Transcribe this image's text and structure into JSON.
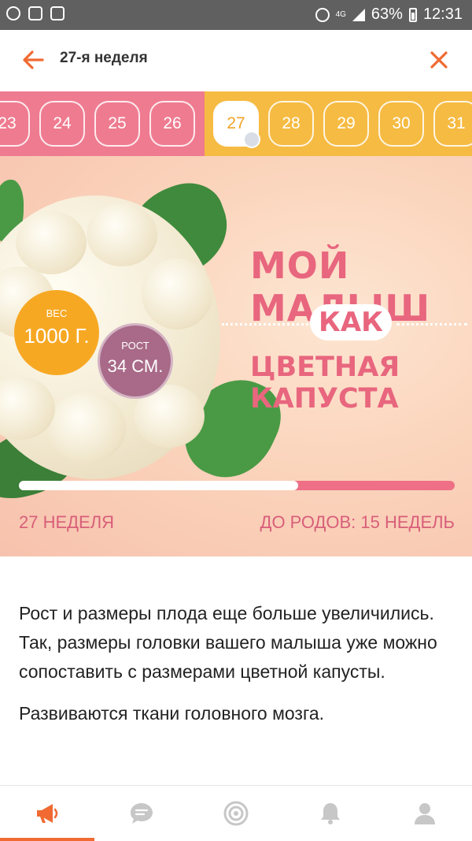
{
  "status_bar": {
    "battery": "63%",
    "time": "12:31",
    "network": "4G"
  },
  "app_bar": {
    "title": "27-я неделя",
    "accent_color": "#f06a32"
  },
  "weeks": {
    "items": [
      "23",
      "24",
      "25",
      "26",
      "27",
      "28",
      "29",
      "30",
      "31"
    ],
    "current": "27",
    "past_color": "#ef7b90",
    "future_color": "#f6bb42"
  },
  "banner": {
    "headline": "МОЙ МАЛЫШ",
    "connector": "КАК",
    "subject": "ЦВЕТНАЯ КАПУСТА",
    "weight_label": "ВЕС",
    "weight_value": "1000 Г.",
    "height_label": "РОСТ",
    "height_value": "34 СМ.",
    "week_label": "27 НЕДЕЛЯ",
    "due_label": "ДО РОДОВ: 15 НЕДЕЛЬ",
    "progress": 0.64
  },
  "article": {
    "paragraphs": [
      "Рост и размеры плода еще больше увеличились. Так, размеры головки вашего малыша уже можно сопоставить с размерами цветной капусты.",
      "Развиваются ткани головного мозга."
    ]
  },
  "bottom_nav": {
    "items": [
      {
        "icon": "megaphone-icon",
        "active": true
      },
      {
        "icon": "chat-icon",
        "active": false
      },
      {
        "icon": "target-icon",
        "active": false
      },
      {
        "icon": "bell-icon",
        "active": false
      },
      {
        "icon": "profile-icon",
        "active": false
      }
    ],
    "active_color": "#f06a32",
    "inactive_color": "#c7c7c7"
  }
}
